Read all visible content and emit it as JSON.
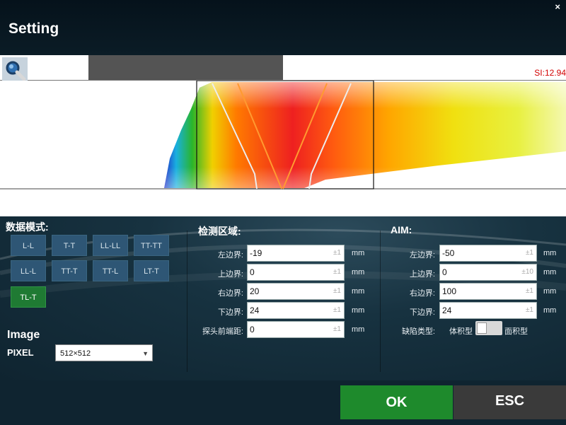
{
  "window": {
    "title": "Setting",
    "close_label": "×"
  },
  "toolbar": {
    "zoom_icon": "magnifier-icon",
    "si_readout": "SI:12.94"
  },
  "data_mode": {
    "label": "数据模式:",
    "modes": [
      "L-L",
      "T-T",
      "LL-LL",
      "TT-TT",
      "LL-L",
      "TT-T",
      "TT-L",
      "LT-T",
      "TL-T"
    ],
    "active": "TL-T"
  },
  "detect_region": {
    "label": "检测区域:",
    "fields": [
      {
        "label": "左边界:",
        "value": "-19",
        "step": "±1",
        "unit": "mm"
      },
      {
        "label": "上边界:",
        "value": "0",
        "step": "±1",
        "unit": "mm"
      },
      {
        "label": "右边界:",
        "value": "20",
        "step": "±1",
        "unit": "mm"
      },
      {
        "label": "下边界:",
        "value": "24",
        "step": "±1",
        "unit": "mm"
      },
      {
        "label": "探头前端距:",
        "value": "0",
        "step": "±1",
        "unit": "mm"
      }
    ]
  },
  "aim": {
    "label": "AIM:",
    "fields": [
      {
        "label": "左边界:",
        "value": "-50",
        "step": "±1",
        "unit": "mm"
      },
      {
        "label": "上边界:",
        "value": "0",
        "step": "±10",
        "unit": "mm"
      },
      {
        "label": "右边界:",
        "value": "100",
        "step": "±1",
        "unit": "mm"
      },
      {
        "label": "下边界:",
        "value": "24",
        "step": "±1",
        "unit": "mm"
      }
    ],
    "defect_type_label": "缺陷类型:",
    "toggle_left": "体积型",
    "toggle_right": "面积型"
  },
  "image": {
    "label": "Image",
    "pixel_label": "PIXEL",
    "pixel_value": "512×512"
  },
  "buttons": {
    "ok": "OK",
    "esc": "ESC"
  },
  "colors": {
    "ok": "#1e8a2c",
    "esc": "#3a3a3a",
    "active_mode": "#1f7a33",
    "mode": "#2e5675",
    "si_readout": "#d20000"
  }
}
